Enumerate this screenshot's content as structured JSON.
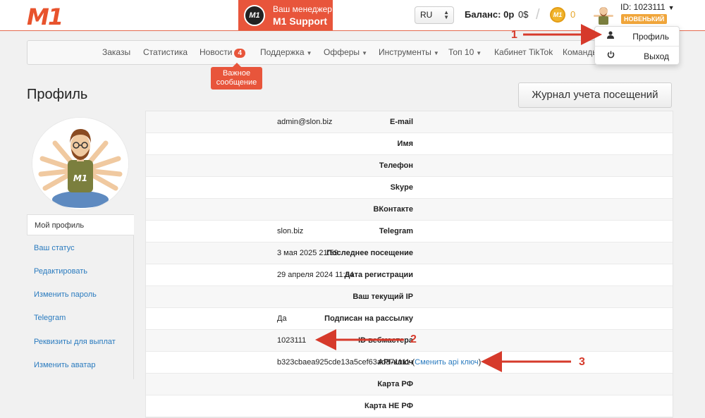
{
  "header": {
    "logo": "M1",
    "manager": {
      "badge": "M1",
      "line1": "Ваш менеджер",
      "line2": "M1 Support"
    },
    "language": "RU",
    "balance": "Баланс: 0р",
    "usd": "0$",
    "coin_icon": "M1",
    "coin_count": "0",
    "user_id": "ID: 1023111",
    "rank": "НОВЕНЬКИЙ"
  },
  "nav": {
    "items": [
      "Заказы",
      "Статистика",
      "Новости",
      "Поддержка",
      "Офферы",
      "Инструменты",
      "Топ 10",
      "Кабинет TikTok",
      "Команды"
    ],
    "news_badge": "4",
    "tooltip": [
      "Важное",
      "сообщение"
    ]
  },
  "dropdown": {
    "profile": "Профиль",
    "logout": "Выход"
  },
  "page": {
    "title": "Профиль",
    "journal_button": "Журнал учета посещений"
  },
  "sidebar": {
    "items": [
      "Мой профиль",
      "Ваш статус",
      "Редактировать",
      "Изменить пароль",
      "Telegram",
      "Реквизиты для выплат",
      "Изменить аватар"
    ]
  },
  "profile": {
    "rows": [
      {
        "label": "E-mail",
        "value": "admin@slon.biz"
      },
      {
        "label": "Имя",
        "value": ""
      },
      {
        "label": "Телефон",
        "value": ""
      },
      {
        "label": "Skype",
        "value": ""
      },
      {
        "label": "ВКонтакте",
        "value": ""
      },
      {
        "label": "Telegram",
        "value": "slon.biz"
      },
      {
        "label": "Последнее посещение",
        "value": "3 мая 2025 21:59"
      },
      {
        "label": "Дата регистрации",
        "value": "29 апреля 2024 11:34"
      },
      {
        "label": "Ваш текущий IP",
        "value": ""
      },
      {
        "label": "Подписан на рассылку",
        "value": "Да"
      },
      {
        "label": "ID вебмастера",
        "value": "1023111"
      },
      {
        "label": "API-ключ",
        "value": "b323cbaea925cde13a5cef63ad371111",
        "link": "Сменить api ключ"
      },
      {
        "label": "Карта РФ",
        "value": ""
      },
      {
        "label": "Карта НЕ РФ",
        "value": ""
      }
    ]
  },
  "annotations": [
    "1",
    "2",
    "3"
  ],
  "colors": {
    "accent": "#e8553b",
    "link": "#2a7bbf",
    "annotation": "#d63a2b",
    "rank": "#f0a53a"
  }
}
